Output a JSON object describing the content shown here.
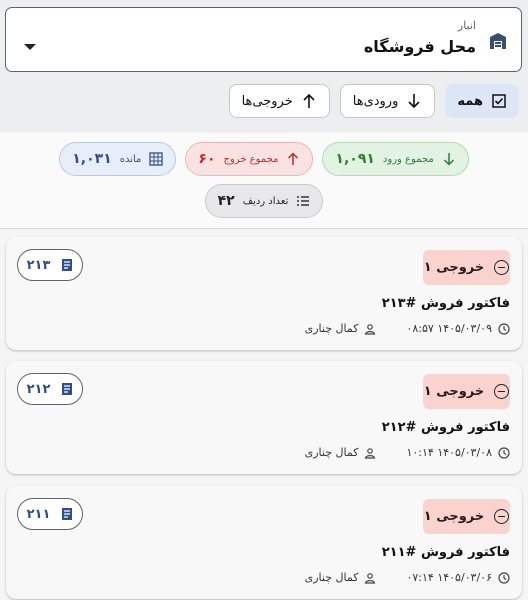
{
  "warehouse": {
    "label": "انبار",
    "value": "محل فروشگاه"
  },
  "filters": [
    {
      "label": "همه",
      "active": true
    },
    {
      "label": "ورودی‌ها",
      "active": false
    },
    {
      "label": "خروجی‌ها",
      "active": false
    }
  ],
  "summary": {
    "in_label": "مجموع ورود",
    "in_value": "۱,۰۹۱",
    "out_label": "مجموع خروج",
    "out_value": "۶۰",
    "balance_label": "مانده",
    "balance_value": "۱,۰۳۱",
    "rows_label": "تعداد ردیف",
    "rows_value": "۴۲"
  },
  "records": [
    {
      "type_label": "خروجی ۱",
      "doc": "۲۱۳",
      "title": "فاکتور فروش #۲۱۳",
      "datetime": "۱۴۰۵/۰۳/۰۹ ۰۸:۵۷",
      "user": "کمال چناری"
    },
    {
      "type_label": "خروجی ۱",
      "doc": "۲۱۲",
      "title": "فاکتور فروش #۲۱۲",
      "datetime": "۱۴۰۵/۰۳/۰۸ ۱۰:۱۴",
      "user": "کمال چناری"
    },
    {
      "type_label": "خروجی ۱",
      "doc": "۲۱۱",
      "title": "فاکتور فروش #۲۱۱",
      "datetime": "۱۴۰۵/۰۳/۰۶ ۰۷:۱۴",
      "user": "کمال چناری"
    }
  ],
  "colors": {
    "accent": "#2f4f86",
    "in": "#2e7d32",
    "out": "#c62828",
    "out_badge_bg": "#fad3cf"
  },
  "icons": {
    "warehouse": "warehouse-icon",
    "dropdown": "caret-down-icon",
    "all": "checklist-icon",
    "in": "arrow-down-icon",
    "out": "arrow-up-icon",
    "balance": "grid-icon",
    "rows": "list-icon",
    "record_type": "minus-circle-icon",
    "doc": "receipt-icon",
    "time": "clock-icon",
    "user": "person-icon"
  }
}
